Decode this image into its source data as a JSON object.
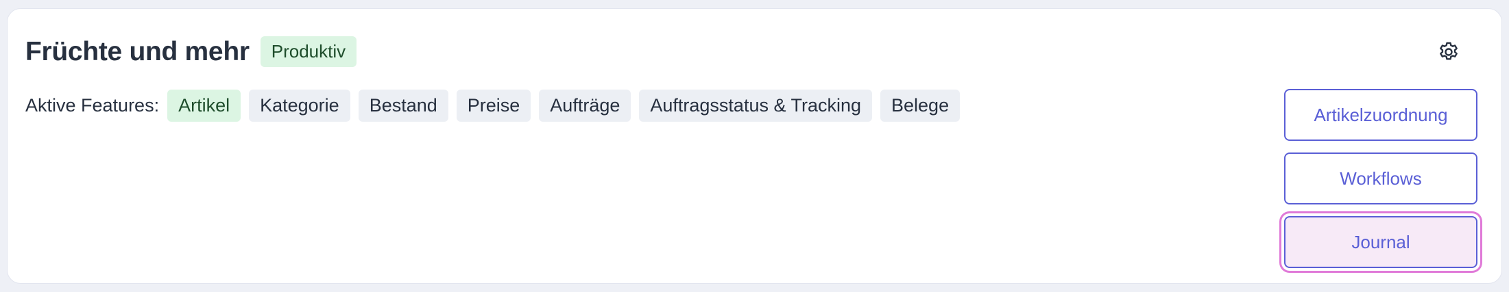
{
  "header": {
    "title": "Früchte und mehr",
    "status_badge": "Produktiv",
    "settings_icon": "gear-icon"
  },
  "features": {
    "label": "Aktive Features:",
    "items": [
      {
        "label": "Artikel",
        "active": true
      },
      {
        "label": "Kategorie",
        "active": false
      },
      {
        "label": "Bestand",
        "active": false
      },
      {
        "label": "Preise",
        "active": false
      },
      {
        "label": "Aufträge",
        "active": false
      },
      {
        "label": "Auftragsstatus & Tracking",
        "active": false
      },
      {
        "label": "Belege",
        "active": false
      }
    ]
  },
  "actions": {
    "artikelzuordnung": "Artikelzuordnung",
    "workflows": "Workflows",
    "journal": "Journal"
  },
  "colors": {
    "accent": "#5a5fd6",
    "active_chip_bg": "#dcf5e3",
    "focus_ring": "#e07ad8"
  }
}
